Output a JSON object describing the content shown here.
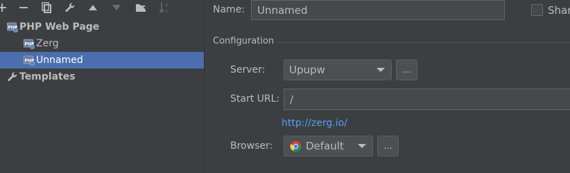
{
  "tree": {
    "items": [
      {
        "label": "PHP Web Page",
        "bold": true
      },
      {
        "label": "Zerg"
      },
      {
        "label": "Unnamed",
        "selected": true
      },
      {
        "label": "Templates",
        "bold": true
      }
    ]
  },
  "form": {
    "name_label": "Name:",
    "name_value": "Unnamed",
    "share_label": "Shar",
    "configuration_label": "Configuration",
    "server_label": "Server:",
    "server_value": "Upupw",
    "server_more": "...",
    "start_url_label": "Start URL:",
    "start_url_value": "/",
    "url_preview": "http://zerg.io/",
    "browser_label": "Browser:",
    "browser_value": "Default",
    "browser_more": "..."
  },
  "colors": {
    "background": "#3c3f41",
    "selection": "#4b6eaf",
    "link": "#589df6"
  }
}
